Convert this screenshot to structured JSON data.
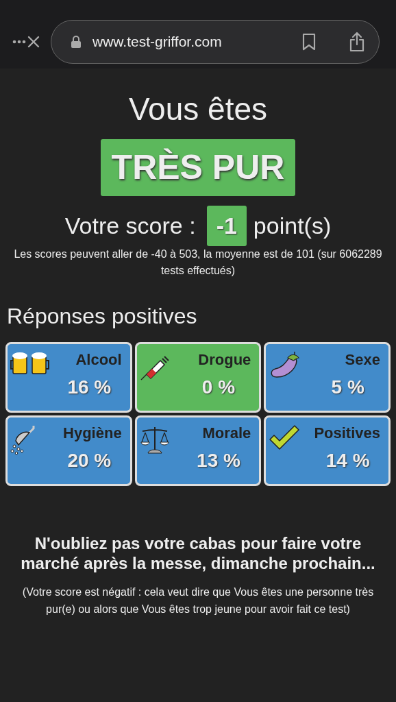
{
  "browser": {
    "url": "www.test-griffor.com"
  },
  "result": {
    "intro": "Vous êtes",
    "verdict": "TRÈS PUR",
    "score_label": "Votre score :",
    "score": "-1",
    "score_unit": "point(s)",
    "score_note": "Les scores peuvent aller de -40 à 503, la moyenne est de 101 (sur 6062289 tests effectués)"
  },
  "section_title": "Réponses positives",
  "categories": [
    {
      "kind": "beer",
      "name": "Alcool",
      "percent": "16 %",
      "color": "#428bca"
    },
    {
      "kind": "syringe",
      "name": "Drogue",
      "percent": "0 %",
      "color": "#5cb85c"
    },
    {
      "kind": "eggplant",
      "name": "Sexe",
      "percent": "5 %",
      "color": "#428bca"
    },
    {
      "kind": "shower",
      "name": "Hygiène",
      "percent": "20 %",
      "color": "#428bca"
    },
    {
      "kind": "scales",
      "name": "Morale",
      "percent": "13 %",
      "color": "#428bca"
    },
    {
      "kind": "check",
      "name": "Positives",
      "percent": "14 %",
      "color": "#428bca"
    }
  ],
  "message": "N'oubliez pas votre cabas pour faire votre marché après la messe, dimanche prochain...",
  "explanation": "(Votre score est négatif : cela veut dire que Vous êtes une personne très pur(e) ou alors que Vous êtes trop jeune pour avoir fait ce test)"
}
